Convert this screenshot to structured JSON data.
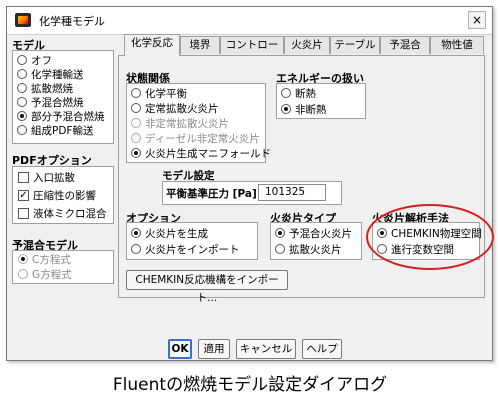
{
  "window": {
    "title": "化学種モデル",
    "close": "×"
  },
  "model": {
    "label": "モデル",
    "options": [
      "オフ",
      "化学種輸送",
      "拡散燃焼",
      "予混合燃焼",
      "部分予混合燃焼",
      "組成PDF輸送"
    ],
    "selected": "部分予混合燃焼"
  },
  "pdf_options": {
    "label": "PDFオプション",
    "items": [
      {
        "label": "入口拡散",
        "checked": false
      },
      {
        "label": "圧縮性の影響",
        "checked": true
      },
      {
        "label": "液体ミクロ混合",
        "checked": false
      }
    ]
  },
  "premix_model": {
    "label": "予混合モデル",
    "options": [
      "C方程式",
      "G方程式"
    ],
    "selected": "C方程式"
  },
  "tabs": [
    "化学反応",
    "境界",
    "コントロール",
    "火炎片",
    "テーブル",
    "予混合",
    "物性値"
  ],
  "active_tab": "化学反応",
  "state_relation": {
    "label": "状態関係",
    "options": [
      "化学平衡",
      "定常拡散火炎片",
      "非定常拡散火炎片",
      "ディーゼル非定常火炎片",
      "火炎片生成マニフォールド"
    ],
    "selected": "火炎片生成マニフォールド"
  },
  "energy": {
    "label": "エネルギーの扱い",
    "options": [
      "断熱",
      "非断熱"
    ],
    "selected": "非断熱"
  },
  "model_settings": {
    "label": "モデル設定",
    "pressure_label": "平衡基準圧力 [Pa]",
    "pressure_value": "101325"
  },
  "options_group": {
    "label": "オプション",
    "options": [
      "火炎片を生成",
      "火炎片をインポート"
    ],
    "selected": "火炎片を生成"
  },
  "flamelet_type": {
    "label": "火炎片タイプ",
    "options": [
      "予混合火炎片",
      "拡散火炎片"
    ],
    "selected": "予混合火炎片"
  },
  "flamelet_solver": {
    "label": "火炎片解析手法",
    "options": [
      "CHEMKIN物理空間",
      "進行変数空間"
    ],
    "selected": "CHEMKIN物理空間"
  },
  "import_button": "CHEMKIN反応機構をインポート...",
  "buttons": {
    "ok": "OK",
    "apply": "適用",
    "cancel": "キャンセル",
    "help": "ヘルプ"
  },
  "caption": "Fluentの燃焼モデル設定ダイアログ",
  "colors": {
    "highlight_ellipse": "#d42020",
    "default_button_border": "#3a6fd8"
  }
}
